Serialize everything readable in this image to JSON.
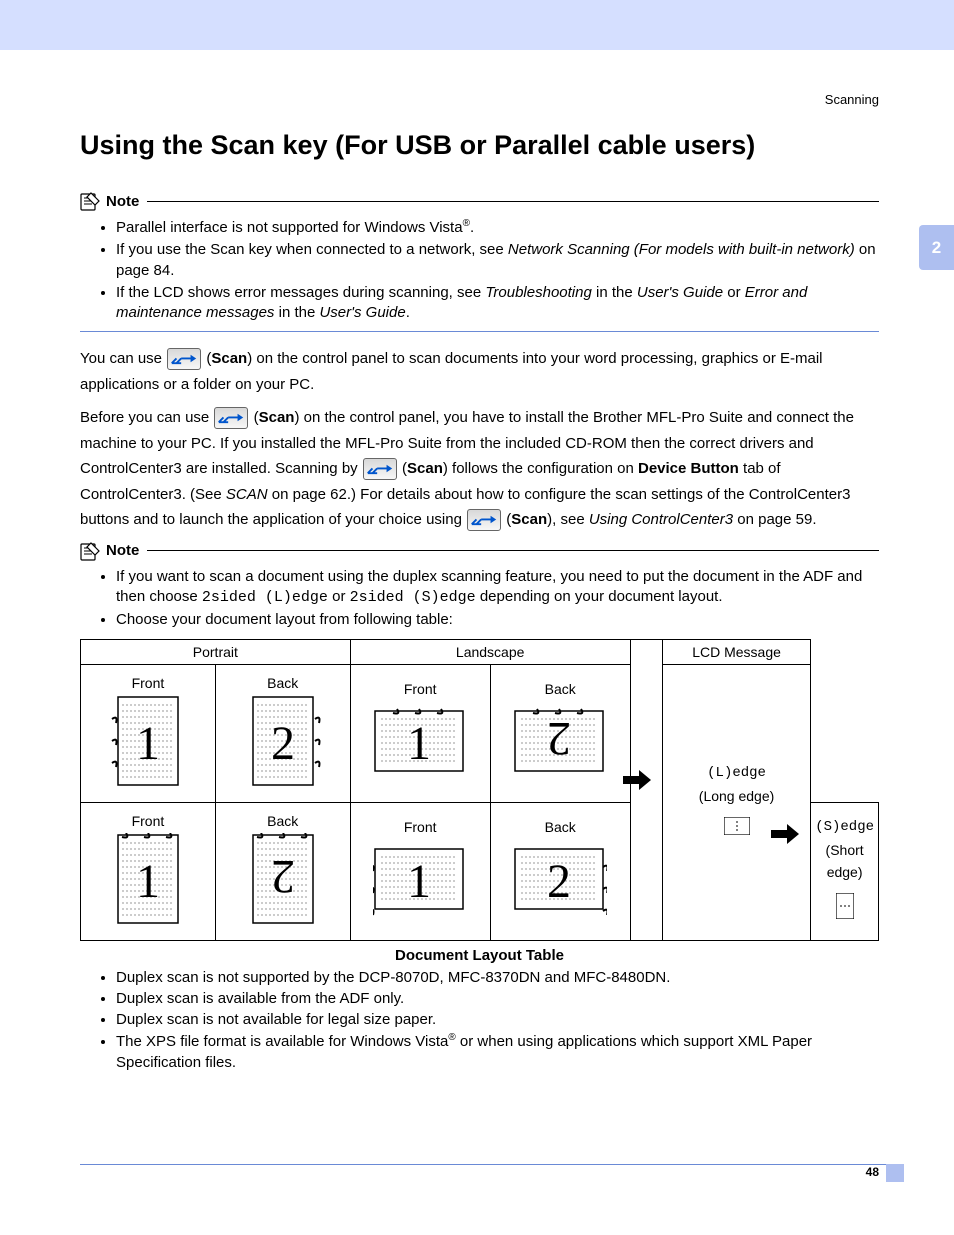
{
  "header": {
    "chapter": "Scanning",
    "sideTab": "2",
    "pageNum": "48"
  },
  "title": "Using the Scan key (For USB or Parallel cable users)",
  "note1": {
    "label": "Note",
    "items": {
      "a_pre": "Parallel interface is not supported for Windows Vista",
      "a_sup": "®",
      "a_post": ".",
      "b_pre": "If you use the Scan key when connected to a network, see ",
      "b_em": "Network Scanning (For models with built-in network)",
      "b_post": " on page 84.",
      "c_pre": "If the LCD shows error messages during scanning, see ",
      "c_em1": "Troubleshooting",
      "c_mid1": " in the ",
      "c_em2": "User's Guide",
      "c_mid2": " or ",
      "c_em3": "Error and maintenance messages",
      "c_mid3": " in the ",
      "c_em4": "User's Guide",
      "c_post": "."
    }
  },
  "para1": {
    "pre": "You can use ",
    "scan": "Scan",
    "post": ") on the control panel to scan documents into your word processing, graphics or E-mail applications or a folder on your PC."
  },
  "para2": {
    "pre": "Before you can use ",
    "scan": "Scan",
    "mid1": ") on the control panel, you have to install the Brother MFL-Pro Suite and connect the machine to your PC. If you installed the MFL-Pro Suite from the included CD-ROM then the correct drivers and ControlCenter3 are installed. Scanning by ",
    "mid2": ") follows the configuration on ",
    "devbtn": "Device Button",
    "mid3": " tab of ControlCenter3. (See ",
    "scanlink": "SCAN",
    "mid4": " on page 62.) For details about how to configure the scan settings of the ControlCenter3 buttons and to launch the application of your choice using ",
    "mid5": "), see ",
    "cc3": "Using ControlCenter3",
    "post": " on page 59."
  },
  "note2": {
    "label": "Note",
    "items": {
      "a_pre": "If you want to scan a document using the duplex scanning feature, you need to put the document in the ADF and then choose ",
      "a_code1": "2sided (L)edge",
      "a_mid": " or ",
      "a_code2": "2sided (S)edge",
      "a_post": " depending on your document layout.",
      "b": "Choose your document layout from following table:"
    }
  },
  "table": {
    "hPortrait": "Portrait",
    "hLandscape": "Landscape",
    "hLcd": "LCD Message",
    "front": "Front",
    "back": "Back",
    "lcd1_code": "(L)edge",
    "lcd1_sub": "(Long edge)",
    "lcd2_code": "(S)edge",
    "lcd2_sub": "(Short edge)",
    "caption": "Document Layout Table"
  },
  "afterlist": {
    "a": "Duplex scan is not supported by the DCP-8070D, MFC-8370DN and MFC-8480DN.",
    "b": "Duplex scan is available from the ADF only.",
    "c": "Duplex scan is not available for legal size paper.",
    "d_pre": "The XPS file format is available for Windows Vista",
    "d_sup": "®",
    "d_post": " or when using applications which support XML Paper Specification files."
  }
}
